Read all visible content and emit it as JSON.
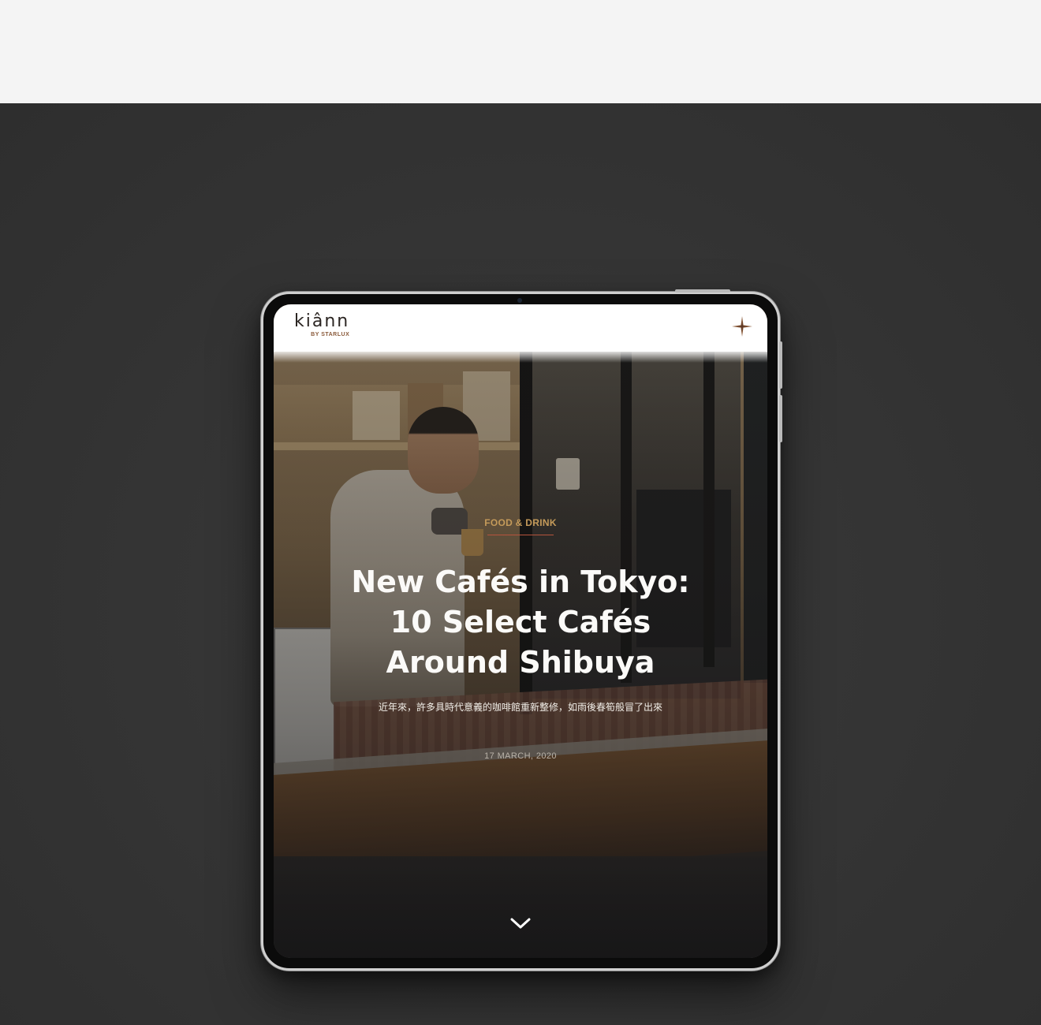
{
  "brand": {
    "logo_word": "kiânn",
    "logo_sub": "BY STARLUX",
    "accent": "#8a5a3a"
  },
  "article": {
    "category": "FOOD & DRINK",
    "title_lines": [
      "New Cafés in Tokyo:",
      "10 Select Cafés",
      "Around Shibuya"
    ],
    "subtitle": "近年來，許多具時代意義的咖啡館重新整修，如雨後春筍般冒了出來",
    "date": "17 MARCH, 2020"
  },
  "colors": {
    "category": "#c49a5a",
    "category_rule": "#b6543d",
    "title": "#fbfaf8",
    "stage_background": "#333333"
  },
  "icons": {
    "menu": "compass-star-icon",
    "scroll": "chevron-down-icon"
  }
}
